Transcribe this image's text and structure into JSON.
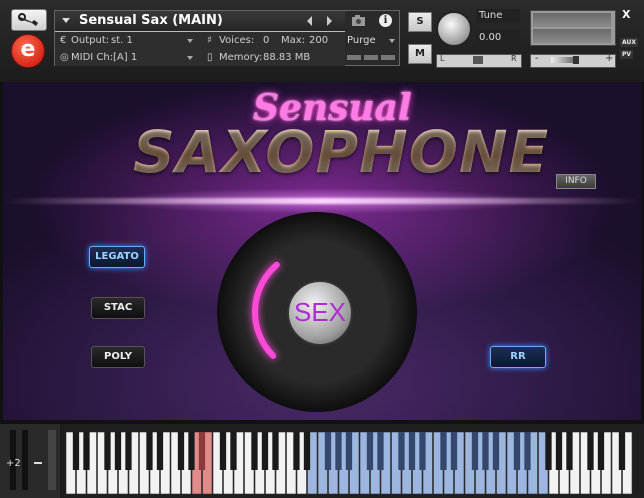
{
  "header": {
    "instrument_title": "Sensual Sax (MAIN)",
    "output_label": "Output:",
    "output_value": "st. 1",
    "voices_label": "Voices:",
    "voices_value": "0",
    "max_label": "Max:",
    "max_value": "200",
    "midi_label": "MIDI Ch:",
    "midi_value": "[A]  1",
    "memory_label": "Memory:",
    "memory_value": "88.83 MB",
    "purge_label": "Purge",
    "solo_label": "S",
    "mute_label": "M",
    "tune_label": "Tune",
    "tune_value": "0.00",
    "pan_left": "L",
    "pan_right": "R",
    "vol_minus": "-",
    "vol_plus": "+",
    "close_label": "X",
    "aux_label": "AUX",
    "pv_label": "PV",
    "logo_letter": "e"
  },
  "panel": {
    "title_script": "Sensual",
    "title_main": "SAXOPHONE",
    "info_button": "INFO",
    "legato_button": "LEGATO",
    "stac_button": "STAC",
    "poly_button": "POLY",
    "rr_button": "RR",
    "center_knob_label": "SEX",
    "knob_level": 0.35
  },
  "keyboard": {
    "octave_label": "+2"
  },
  "colors": {
    "accent_magenta": "#ff4ad8",
    "legato_glow": "#3a8cff",
    "key_range_blue": "#9cb6e0",
    "key_switch_red": "#e08a8a"
  }
}
